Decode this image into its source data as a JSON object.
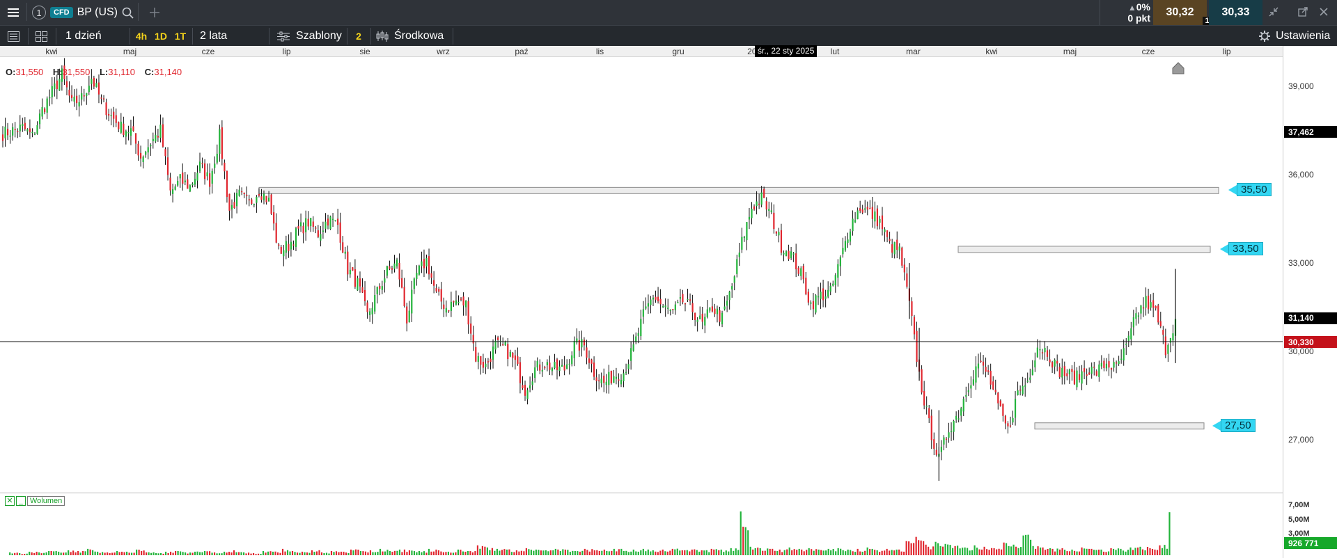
{
  "topbar": {
    "menu_icon": "hamburger-icon",
    "tab_number": "1",
    "instrument_type": "CFD",
    "instrument_name": "BP (US)",
    "change_pct": "0%",
    "change_pts": "0 pkt",
    "sell_price": "30,32",
    "buy_price": "30,33",
    "spread_badge": "1"
  },
  "toolbar": {
    "interval": "1 dzień",
    "quick_intervals": [
      "4h",
      "1D",
      "1T"
    ],
    "range": "2 lata",
    "templates": "Szablony",
    "indicator_count": "2",
    "indicator": "Środkowa",
    "settings": "Ustawienia"
  },
  "ohlc": {
    "o_label": "O:",
    "o": "31,550",
    "h_label": "H:",
    "h": "31,550",
    "l_label": "L:",
    "l": "31,110",
    "c_label": "C:",
    "c": "31,140"
  },
  "cursor_date": "śr., 22 sty 2025",
  "volume": {
    "legend": "Wolumen",
    "current": "926 771",
    "ticks": [
      "7,00M",
      "5,00M",
      "3,00M"
    ]
  },
  "colors": {
    "up": "#22b33a",
    "down": "#e0262e",
    "toolbar_bg": "#25292e",
    "accent_yellow": "#f3d21b",
    "level_cyan": "#33d6f2",
    "current_price_red": "#c4111a"
  },
  "chart_data": {
    "type": "candlestick",
    "instrument": "BP (US)",
    "timeframe": "1 dzień",
    "x_months": [
      "kwi",
      "maj",
      "cze",
      "lip",
      "sie",
      "wrz",
      "paź",
      "lis",
      "gru",
      "2025",
      "lut",
      "mar",
      "kwi",
      "maj",
      "cze",
      "lip"
    ],
    "y_ticks": [
      39,
      36,
      33,
      30,
      27
    ],
    "y_tick_labels": [
      "39,000",
      "36,000",
      "33,000",
      "30,000",
      "27,000"
    ],
    "ylim": [
      25.2,
      40.0
    ],
    "last_close_label": "31,140",
    "current_price": 30.33,
    "current_price_label": "30,330",
    "marker_price": 37.462,
    "marker_price_label": "37,462",
    "horizontal_levels": [
      {
        "value": 35.5,
        "label": "35,50"
      },
      {
        "value": 33.5,
        "label": "33,50"
      },
      {
        "value": 27.5,
        "label": "27,50"
      }
    ],
    "close_path": [
      [
        0,
        37.4
      ],
      [
        1,
        37.5
      ],
      [
        2,
        37.6
      ],
      [
        3,
        37.3
      ],
      [
        4,
        38.2
      ],
      [
        5,
        38.8
      ],
      [
        6,
        39.4
      ],
      [
        7,
        38.4
      ],
      [
        8,
        38.6
      ],
      [
        9,
        39.3
      ],
      [
        10,
        38.5
      ],
      [
        11,
        38.0
      ],
      [
        12,
        37.6
      ],
      [
        13,
        37.5
      ],
      [
        14,
        36.6
      ],
      [
        15,
        37.1
      ],
      [
        16,
        37.5
      ],
      [
        17,
        35.4
      ],
      [
        18,
        35.8
      ],
      [
        19,
        35.6
      ],
      [
        20,
        36.3
      ],
      [
        21,
        35.8
      ],
      [
        22,
        37.3
      ],
      [
        23,
        34.8
      ],
      [
        24,
        35.3
      ],
      [
        25,
        35.0
      ],
      [
        26,
        35.5
      ],
      [
        27,
        35.1
      ],
      [
        28,
        33.4
      ],
      [
        29,
        33.6
      ],
      [
        30,
        34.1
      ],
      [
        31,
        34.4
      ],
      [
        32,
        34.0
      ],
      [
        33,
        34.5
      ],
      [
        34,
        34.3
      ],
      [
        35,
        32.8
      ],
      [
        36,
        32.3
      ],
      [
        37,
        31.2
      ],
      [
        38,
        32.0
      ],
      [
        39,
        32.7
      ],
      [
        40,
        33.0
      ],
      [
        41,
        31.1
      ],
      [
        42,
        32.6
      ],
      [
        43,
        33.1
      ],
      [
        44,
        31.9
      ],
      [
        45,
        31.5
      ],
      [
        46,
        31.7
      ],
      [
        47,
        31.6
      ],
      [
        48,
        29.8
      ],
      [
        49,
        29.5
      ],
      [
        50,
        30.2
      ],
      [
        51,
        30.1
      ],
      [
        52,
        29.6
      ],
      [
        53,
        28.7
      ],
      [
        54,
        29.4
      ],
      [
        55,
        29.6
      ],
      [
        56,
        29.4
      ],
      [
        57,
        29.4
      ],
      [
        58,
        30.2
      ],
      [
        59,
        30.2
      ],
      [
        60,
        29.3
      ],
      [
        61,
        28.9
      ],
      [
        62,
        29.2
      ],
      [
        63,
        29.3
      ],
      [
        64,
        30.1
      ],
      [
        65,
        31.2
      ],
      [
        66,
        31.9
      ],
      [
        67,
        31.5
      ],
      [
        68,
        31.3
      ],
      [
        69,
        31.7
      ],
      [
        70,
        31.4
      ],
      [
        71,
        30.9
      ],
      [
        72,
        31.5
      ],
      [
        73,
        31.1
      ],
      [
        74,
        32.2
      ],
      [
        75,
        33.7
      ],
      [
        76,
        34.9
      ],
      [
        77,
        35.2
      ],
      [
        78,
        34.6
      ],
      [
        79,
        33.6
      ],
      [
        80,
        33.3
      ],
      [
        81,
        32.6
      ],
      [
        82,
        31.6
      ],
      [
        83,
        31.9
      ],
      [
        84,
        32.0
      ],
      [
        85,
        33.1
      ],
      [
        86,
        34.3
      ],
      [
        87,
        34.9
      ],
      [
        88,
        34.7
      ],
      [
        89,
        34.4
      ],
      [
        90,
        33.6
      ],
      [
        91,
        33.4
      ],
      [
        92,
        31.6
      ],
      [
        93,
        29.2
      ],
      [
        94,
        27.5
      ],
      [
        95,
        26.3
      ],
      [
        96,
        27.4
      ],
      [
        97,
        27.9
      ],
      [
        98,
        28.9
      ],
      [
        99,
        29.6
      ],
      [
        100,
        29.2
      ],
      [
        101,
        28.1
      ],
      [
        102,
        27.3
      ],
      [
        103,
        28.6
      ],
      [
        104,
        29.0
      ],
      [
        105,
        30.2
      ],
      [
        106,
        30.0
      ],
      [
        107,
        29.4
      ],
      [
        108,
        29.2
      ],
      [
        109,
        29.1
      ],
      [
        110,
        29.4
      ],
      [
        111,
        29.3
      ],
      [
        112,
        29.6
      ],
      [
        113,
        29.4
      ],
      [
        114,
        30.1
      ],
      [
        115,
        31.2
      ],
      [
        116,
        31.7
      ],
      [
        117,
        31.3
      ],
      [
        118,
        30.1
      ],
      [
        119,
        31.1
      ]
    ],
    "wick_spikes": [
      {
        "index": 92,
        "high": 33.0,
        "low": 31.1
      },
      {
        "index": 93,
        "high": 30.8,
        "low": 29.0
      },
      {
        "index": 95,
        "high": 28.0,
        "low": 25.6
      },
      {
        "index": 119,
        "high": 32.8,
        "low": 29.6
      }
    ],
    "volume_millions": [
      0.4,
      0.3,
      0.5,
      0.4,
      0.6,
      0.5,
      0.7,
      0.6,
      0.9,
      0.5,
      0.4,
      0.6,
      0.5,
      0.8,
      0.4,
      0.3,
      0.5,
      0.6,
      0.4,
      0.5,
      0.6,
      0.4,
      0.5,
      0.7,
      0.4,
      0.3,
      0.6,
      0.5,
      0.9,
      0.6,
      0.5,
      0.7,
      0.4,
      0.6,
      0.5,
      0.8,
      0.6,
      0.7,
      0.9,
      0.6,
      0.8,
      0.7,
      0.6,
      0.9,
      0.7,
      0.5,
      0.8,
      0.6,
      1.4,
      1.1,
      0.9,
      0.8,
      0.7,
      1.0,
      0.8,
      0.7,
      0.9,
      0.8,
      0.6,
      0.9,
      0.7,
      0.8,
      0.9,
      0.6,
      0.8,
      0.9,
      0.7,
      0.8,
      0.9,
      0.7,
      0.8,
      0.7,
      0.9,
      0.8,
      1.0,
      6.2,
      1.2,
      1.0,
      0.9,
      0.8,
      1.1,
      0.9,
      1.0,
      0.8,
      0.9,
      1.0,
      0.8,
      0.9,
      1.1,
      0.7,
      0.9,
      0.8,
      2.0,
      2.6,
      1.5,
      1.9,
      1.6,
      1.3,
      1.1,
      1.4,
      1.2,
      1.0,
      1.8,
      1.5,
      2.8,
      1.3,
      1.1,
      0.9,
      1.0,
      0.8,
      1.1,
      0.9,
      0.8,
      1.0,
      0.9,
      1.1,
      1.2,
      1.0,
      1.4,
      6.1
    ],
    "volume_ticks_millions": [
      7,
      5,
      3
    ],
    "volume_current": 926771
  }
}
